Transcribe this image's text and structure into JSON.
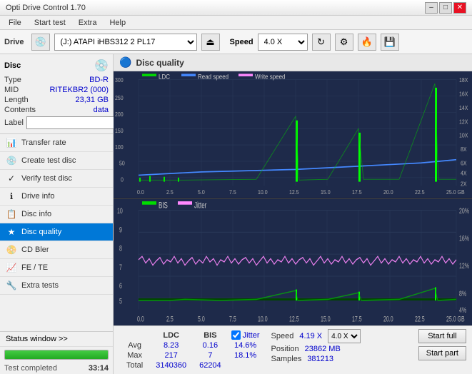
{
  "app": {
    "title": "Opti Drive Control 1.70",
    "title_controls": [
      "–",
      "□",
      "✕"
    ]
  },
  "menu": {
    "items": [
      "File",
      "Start test",
      "Extra",
      "Help"
    ]
  },
  "toolbar": {
    "drive_label": "Drive",
    "drive_value": "(J:)  ATAPI iHBS312  2 PL17",
    "speed_label": "Speed",
    "speed_value": "4.0 X"
  },
  "disc": {
    "title": "Disc",
    "type_label": "Type",
    "type_value": "BD-R",
    "mid_label": "MID",
    "mid_value": "RITEKBR2 (000)",
    "length_label": "Length",
    "length_value": "23,31 GB",
    "contents_label": "Contents",
    "contents_value": "data",
    "label_label": "Label",
    "label_placeholder": ""
  },
  "nav": {
    "items": [
      {
        "id": "transfer-rate",
        "label": "Transfer rate",
        "icon": "📊"
      },
      {
        "id": "create-test-disc",
        "label": "Create test disc",
        "icon": "💿"
      },
      {
        "id": "verify-test-disc",
        "label": "Verify test disc",
        "icon": "✓"
      },
      {
        "id": "drive-info",
        "label": "Drive info",
        "icon": "ℹ"
      },
      {
        "id": "disc-info",
        "label": "Disc info",
        "icon": "📋"
      },
      {
        "id": "disc-quality",
        "label": "Disc quality",
        "icon": "★",
        "active": true
      },
      {
        "id": "cd-bler",
        "label": "CD Bler",
        "icon": "📀"
      },
      {
        "id": "fe-te",
        "label": "FE / TE",
        "icon": "📈"
      },
      {
        "id": "extra-tests",
        "label": "Extra tests",
        "icon": "🔧"
      }
    ]
  },
  "status_window": {
    "label": "Status window  >>",
    "progress_pct": 100,
    "status_text": "Test completed",
    "time": "33:14"
  },
  "chart": {
    "title": "Disc quality",
    "icon": "🔵",
    "legend_top": [
      {
        "label": "LDC",
        "color": "#00ff00"
      },
      {
        "label": "Read speed",
        "color": "#4488ff"
      },
      {
        "label": "Write speed",
        "color": "#ff88ff"
      }
    ],
    "legend_bottom": [
      {
        "label": "BIS",
        "color": "#00ff00"
      },
      {
        "label": "Jitter",
        "color": "#ff88ff"
      }
    ],
    "x_axis_max": "25.0 GB",
    "x_ticks": [
      "0.0",
      "2.5",
      "5.0",
      "7.5",
      "10.0",
      "12.5",
      "15.0",
      "17.5",
      "20.0",
      "22.5",
      "25.0"
    ],
    "top_y_left_max": 300,
    "top_y_right_max": "18X",
    "bottom_y_max": 10
  },
  "stats": {
    "columns": [
      "",
      "LDC",
      "BIS",
      "",
      "Jitter",
      "Speed",
      ""
    ],
    "avg_label": "Avg",
    "avg_ldc": "8.23",
    "avg_bis": "0.16",
    "avg_jitter": "14.6%",
    "max_label": "Max",
    "max_ldc": "217",
    "max_bis": "7",
    "max_jitter": "18.1%",
    "total_label": "Total",
    "total_ldc": "3140360",
    "total_bis": "62204",
    "jitter_checked": true,
    "jitter_label": "Jitter",
    "speed_label": "Speed",
    "speed_value": "4.19 X",
    "speed_select": "4.0 X",
    "position_label": "Position",
    "position_value": "23862 MB",
    "samples_label": "Samples",
    "samples_value": "381213",
    "start_full_label": "Start full",
    "start_part_label": "Start part"
  }
}
